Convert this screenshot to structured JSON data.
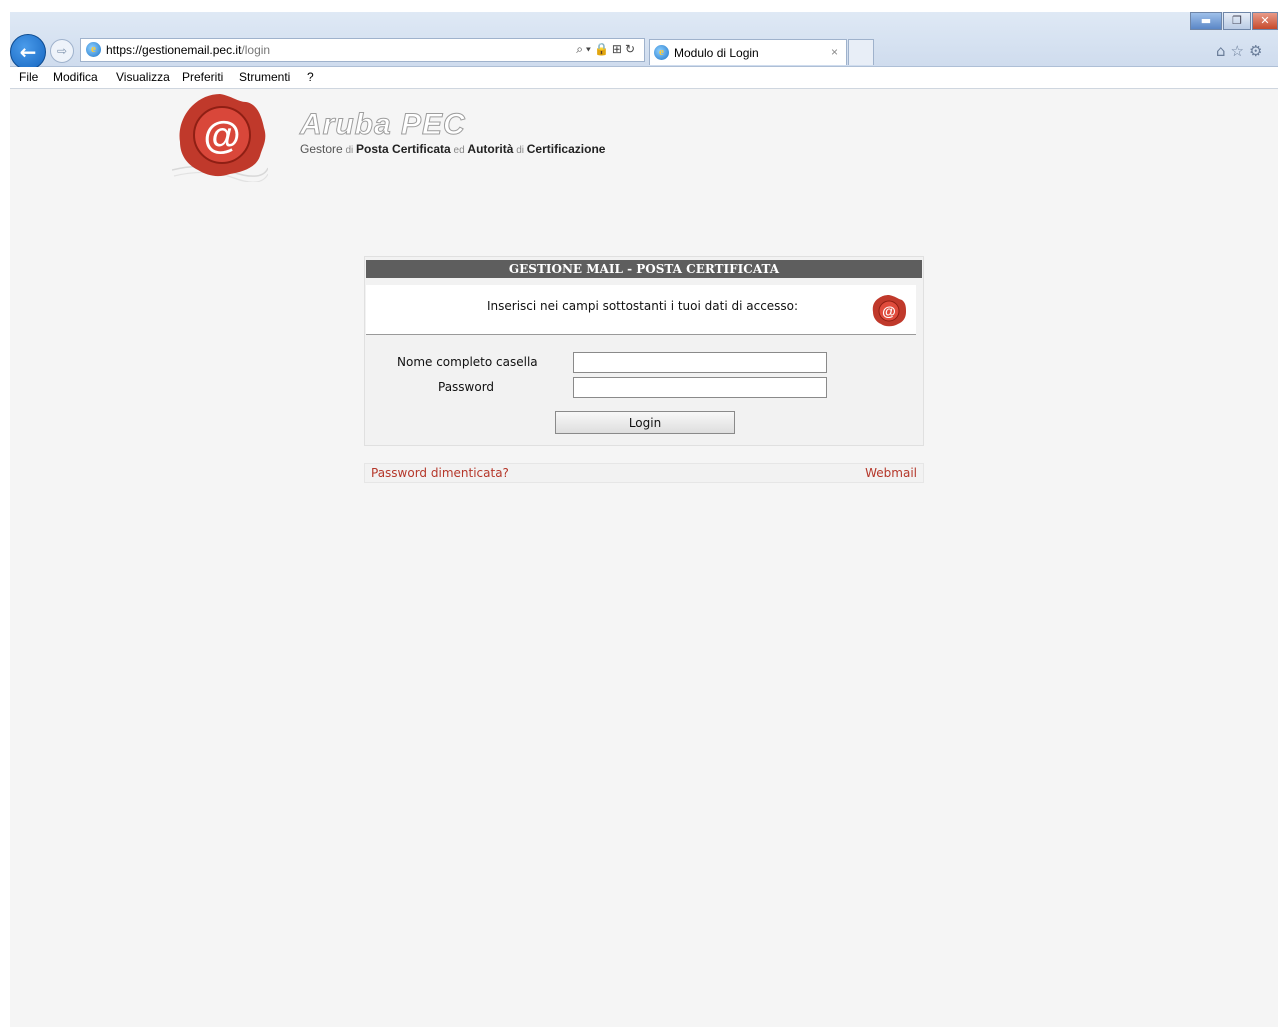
{
  "browser": {
    "url_prefix": "https://gestionemail.",
    "url_domain": "pec.it",
    "url_path": "/login",
    "tab_title": "Modulo di Login",
    "tab_close": "×",
    "addr_tools": "⌕▾🔒⊞↻"
  },
  "menu": {
    "items": [
      "File",
      "Modifica",
      "Visualizza",
      "Preferiti",
      "Strumenti",
      "?"
    ]
  },
  "logo": {
    "brand": "Aruba PEC",
    "tagline": [
      "Gestore",
      " di ",
      "Posta Certificata",
      " ed ",
      "Autorità",
      " di ",
      "Certificazione"
    ]
  },
  "login": {
    "header": "GESTIONE MAIL - POSTA CERTIFICATA",
    "intro": "Inserisci nei campi sottostanti i tuoi dati di accesso:",
    "username_label": "Nome completo casella",
    "username_value": "",
    "password_label": "Password",
    "password_value": "",
    "button_label": "Login"
  },
  "links": {
    "forgot_password": "Password dimenticata?",
    "webmail": "Webmail"
  },
  "colors": {
    "link": "#b5372a",
    "header_bg": "#5e5e5e",
    "seal": "#c0392b"
  }
}
